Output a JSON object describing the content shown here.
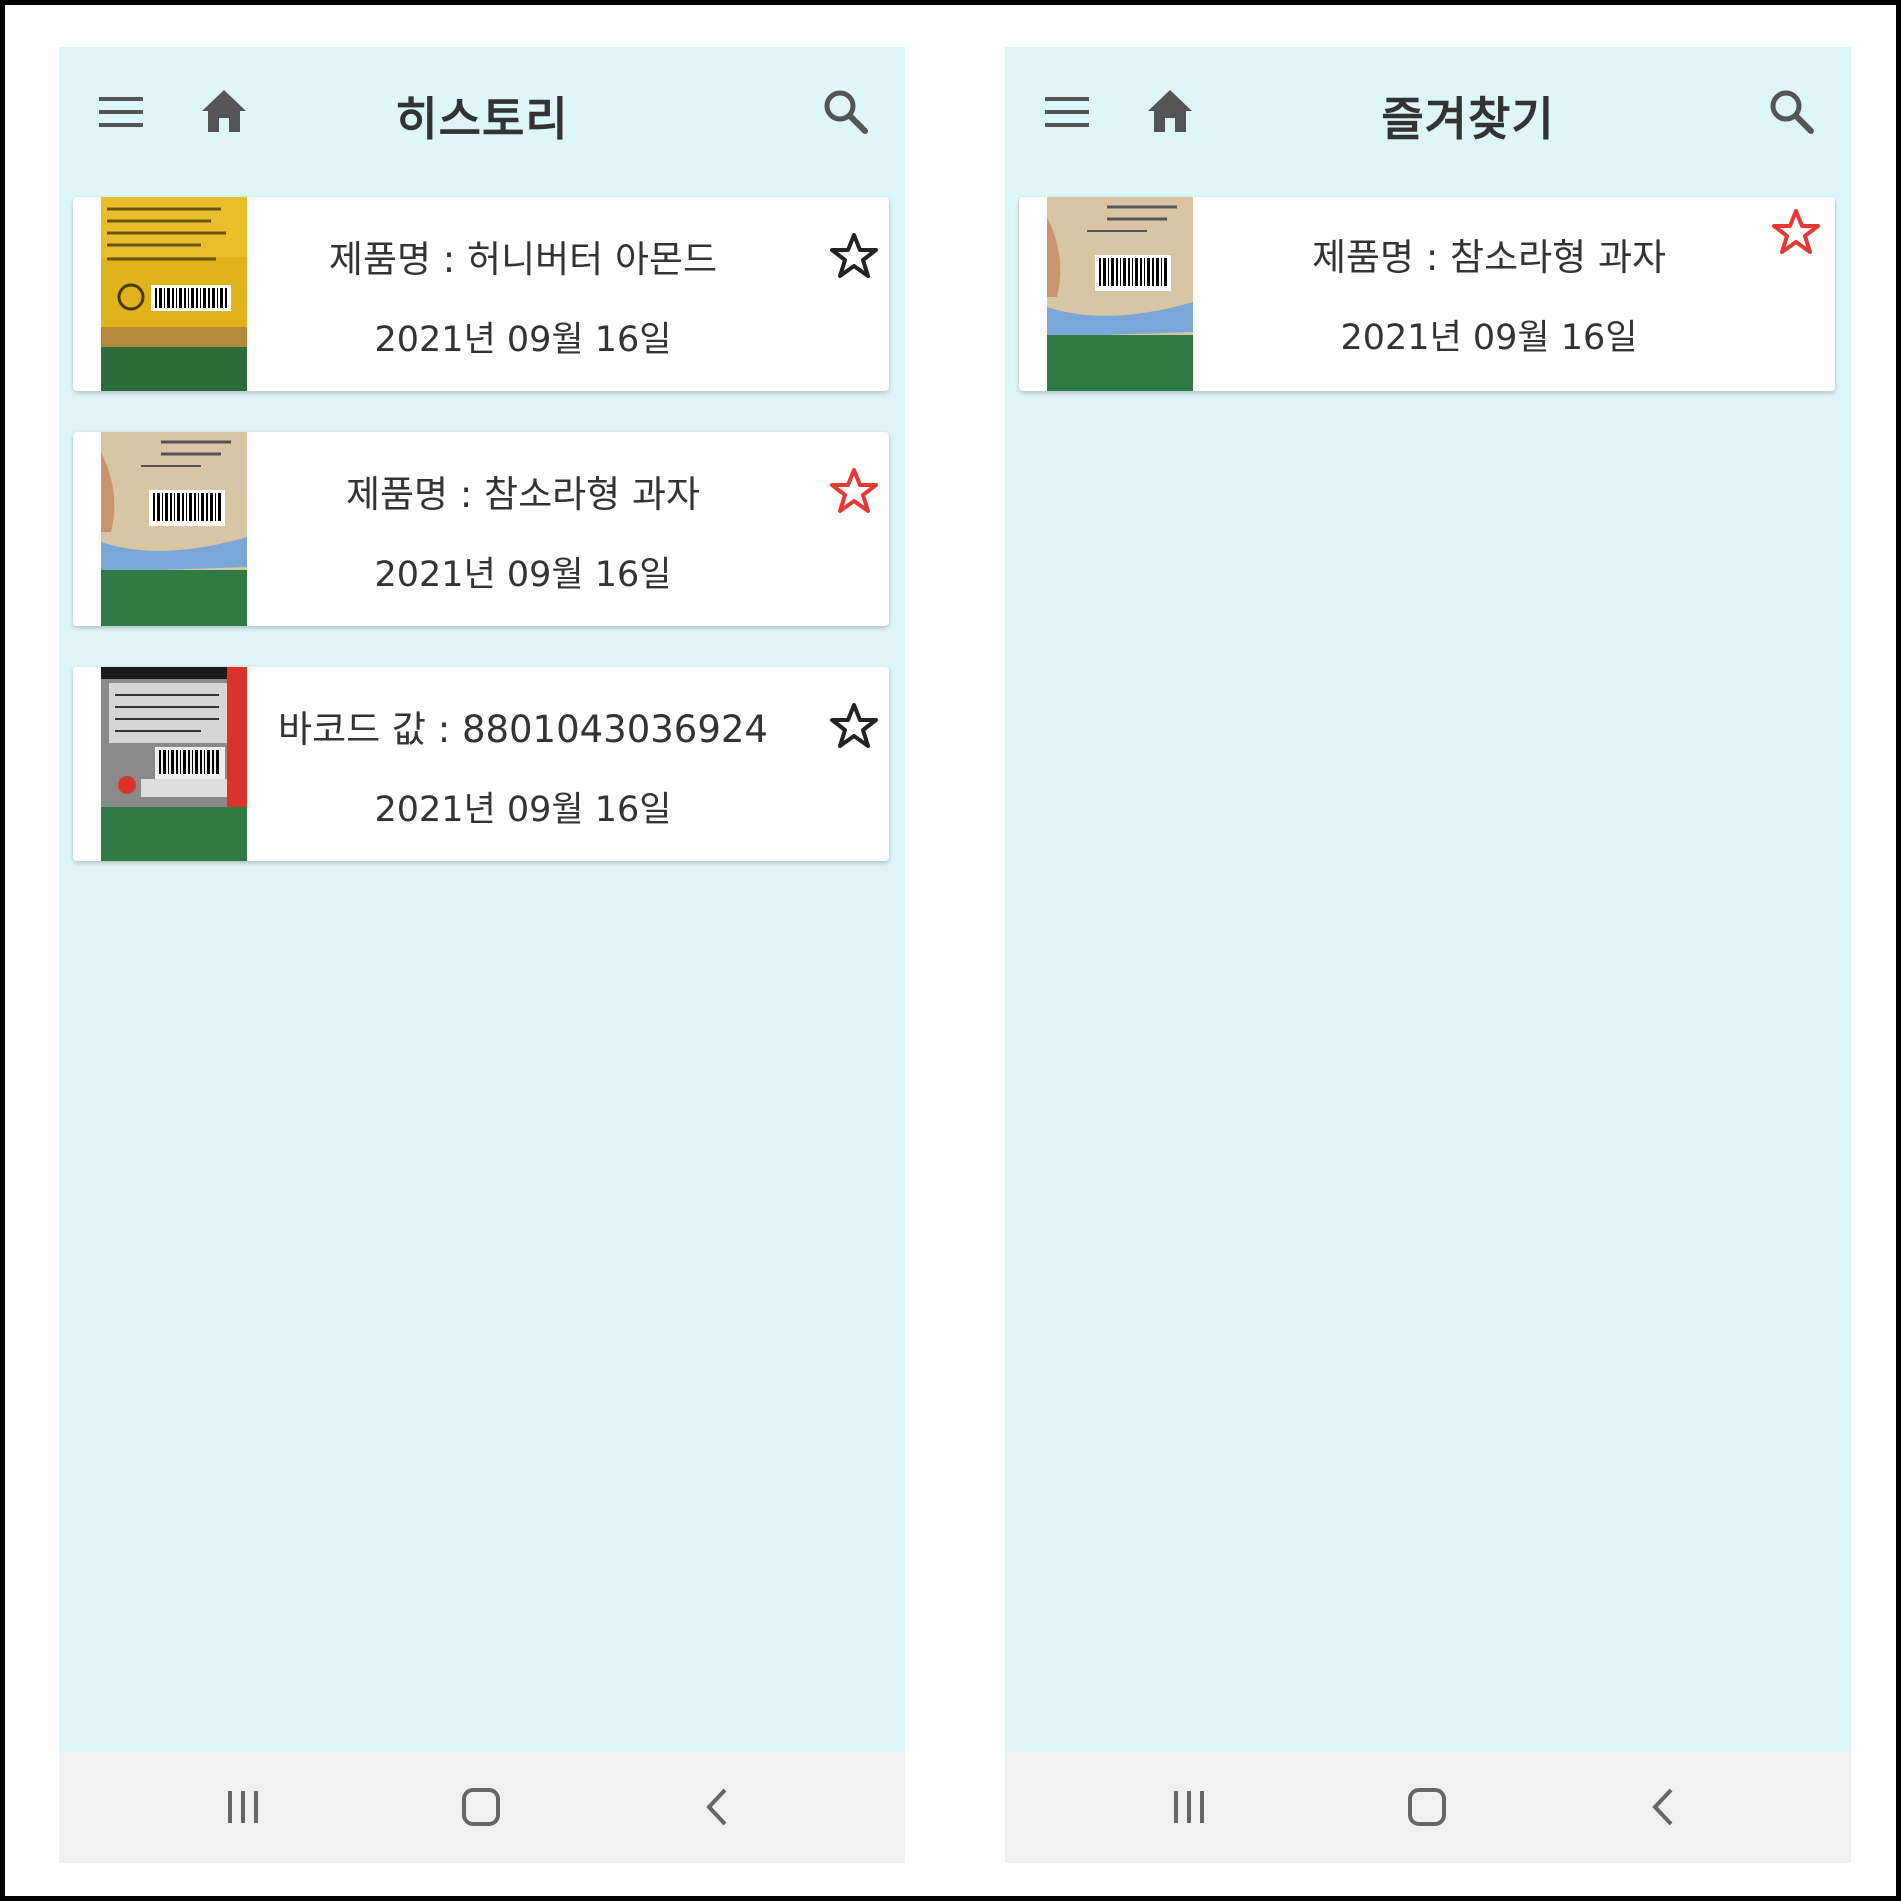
{
  "colors": {
    "background": "#dff6f6",
    "card": "#ffffff",
    "text": "#333333",
    "icon": "#555555",
    "favorite_star": "#e53935",
    "navbar": "#f1f1f1"
  },
  "history_screen": {
    "title": "히스토리",
    "icons": {
      "menu": "hamburger-menu-icon",
      "home": "home-icon",
      "search": "search-icon"
    },
    "items": [
      {
        "title": "제품명 : 허니버터 아몬드",
        "date": "2021년 09월 16일",
        "favorite": false,
        "thumbnail": "yellow snack package label with barcode"
      },
      {
        "title": "제품명 : 참소라형 과자",
        "date": "2021년 09월 16일",
        "favorite": true,
        "thumbnail": "beige snack bag with barcode"
      },
      {
        "title": "바코드 값 : 8801043036924",
        "date": "2021년 09월 16일",
        "favorite": false,
        "thumbnail": "red noodle package label with barcode"
      }
    ]
  },
  "favorites_screen": {
    "title": "즐겨찾기",
    "icons": {
      "menu": "hamburger-menu-icon",
      "home": "home-icon",
      "search": "search-icon"
    },
    "items": [
      {
        "title": "제품명 : 참소라형 과자",
        "date": "2021년 09월 16일",
        "favorite": true,
        "thumbnail": "beige snack bag with barcode"
      }
    ]
  },
  "system_nav": {
    "icons": [
      "recent-apps-icon",
      "home-circle-icon",
      "back-icon"
    ]
  }
}
